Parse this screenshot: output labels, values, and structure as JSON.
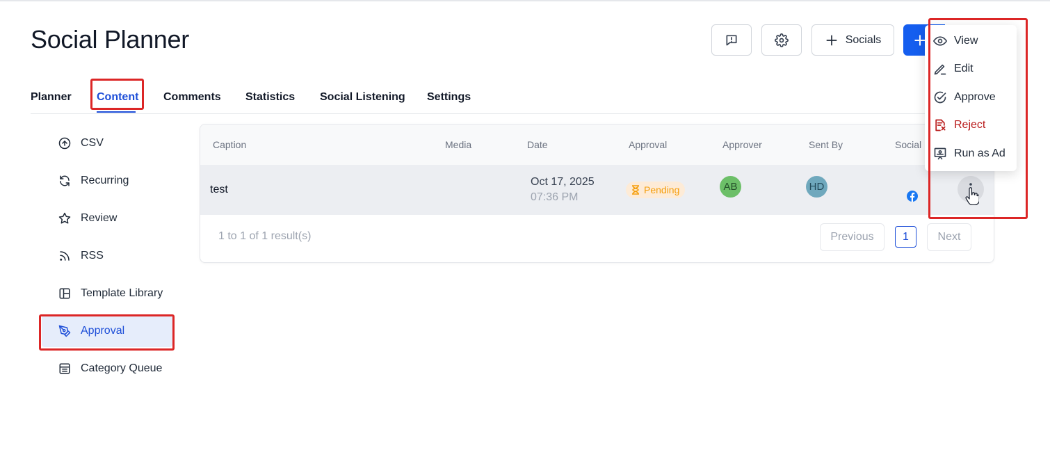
{
  "header": {
    "title": "Social Planner",
    "socials_label": "Socials"
  },
  "tabs": [
    {
      "label": "Planner"
    },
    {
      "label": "Content"
    },
    {
      "label": "Comments"
    },
    {
      "label": "Statistics"
    },
    {
      "label": "Social Listening"
    },
    {
      "label": "Settings"
    }
  ],
  "sidebar": {
    "items": [
      {
        "label": "CSV",
        "icon": "upload-circle-icon"
      },
      {
        "label": "Recurring",
        "icon": "refresh-icon"
      },
      {
        "label": "Review",
        "icon": "star-icon"
      },
      {
        "label": "RSS",
        "icon": "rss-icon"
      },
      {
        "label": "Template Library",
        "icon": "template-icon"
      },
      {
        "label": "Approval",
        "icon": "pen-tool-icon"
      },
      {
        "label": "Category Queue",
        "icon": "list-icon"
      }
    ]
  },
  "table": {
    "columns": [
      "Caption",
      "Media",
      "Date",
      "Approval",
      "Approver",
      "Sent By",
      "Social"
    ],
    "rows": [
      {
        "caption": "test",
        "date": "Oct 17, 2025",
        "time": "07:36 PM",
        "approval": "Pending",
        "approver_initials": "AB",
        "sent_by_initials": "HD",
        "social_icon": "facebook-icon"
      }
    ]
  },
  "pagination": {
    "summary": "1 to 1 of 1 result(s)",
    "previous": "Previous",
    "page": "1",
    "next": "Next"
  },
  "context_menu": {
    "items": [
      {
        "label": "View",
        "icon": "eye-icon"
      },
      {
        "label": "Edit",
        "icon": "pencil-icon"
      },
      {
        "label": "Approve",
        "icon": "check-circle-icon"
      },
      {
        "label": "Reject",
        "icon": "reject-doc-icon"
      },
      {
        "label": "Run as Ad",
        "icon": "ad-icon"
      }
    ]
  },
  "colors": {
    "accent": "#1d4ed8",
    "primary_button": "#155eef",
    "highlight_box": "#dc2626",
    "pending_text": "#f59e0b",
    "reject_text": "#b91c1c"
  }
}
